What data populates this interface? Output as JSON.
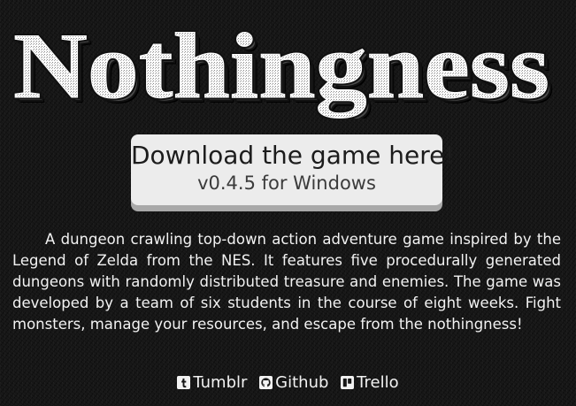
{
  "header": {
    "logo_text": "Nothingness"
  },
  "download": {
    "title": "Download the game here!",
    "subtitle": "v0.4.5 for Windows"
  },
  "description": {
    "text": "A dungeon crawling top-down action adventure game inspired by the Legend of Zelda from the NES. It features five procedurally generated dungeons with randomly distributed treasure and enemies. The game was developed by a team of six students in the course of eight weeks. Fight monsters, manage your resources, and escape from the nothingness!"
  },
  "links": [
    {
      "label": "Tumblr",
      "icon": "tumblr-icon"
    },
    {
      "label": "Github",
      "icon": "github-icon"
    },
    {
      "label": "Trello",
      "icon": "trello-icon"
    }
  ],
  "colors": {
    "background": "#161616",
    "text": "#f2f2f2",
    "button_face": "#ececec",
    "button_shadow": "#a9a9a9",
    "logo_fill": "#ffffff",
    "logo_outline": "#111111"
  }
}
